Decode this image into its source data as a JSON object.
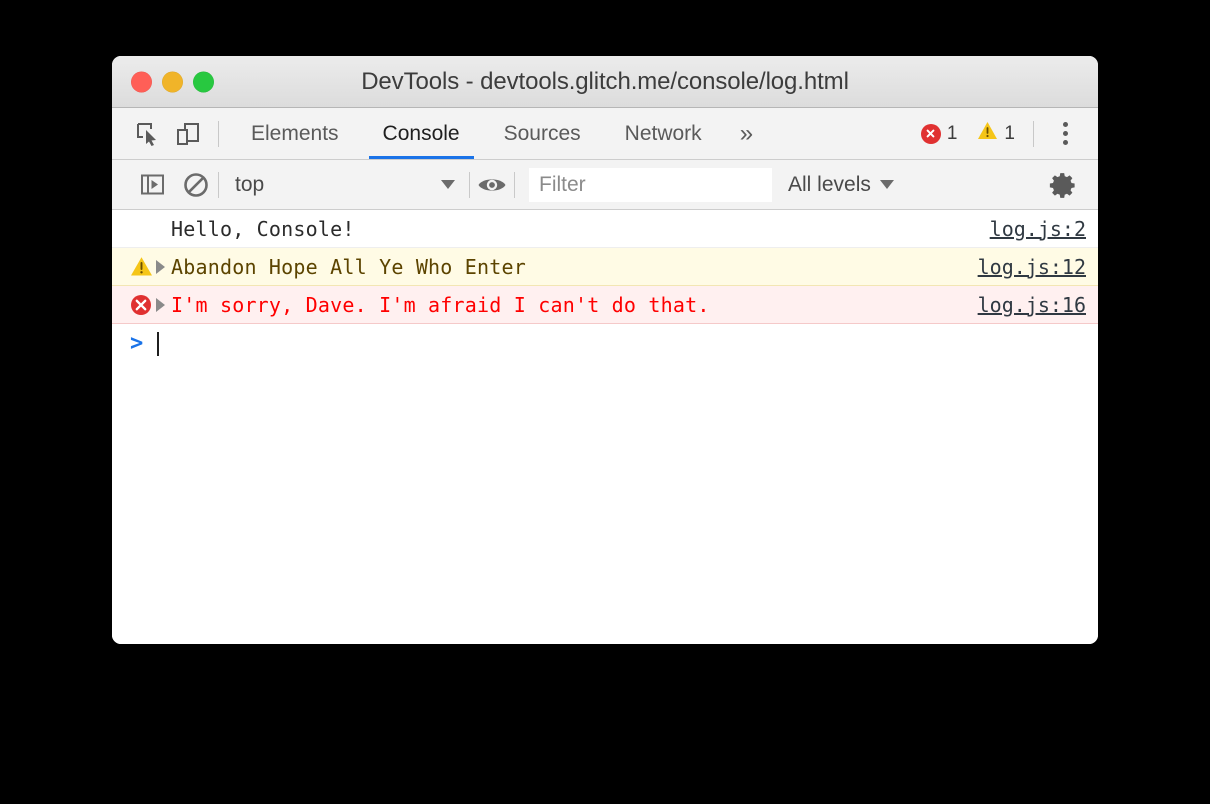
{
  "window": {
    "title": "DevTools - devtools.glitch.me/console/log.html",
    "traffic_lights": [
      {
        "name": "close",
        "color": "#ff5f57"
      },
      {
        "name": "minimize",
        "color": "#f0b429"
      },
      {
        "name": "maximize",
        "color": "#28c840"
      }
    ]
  },
  "tabbar": {
    "inspect_icon": "inspect-element-icon",
    "device_icon": "device-toolbar-icon",
    "tabs": [
      {
        "label": "Elements",
        "active": false
      },
      {
        "label": "Console",
        "active": true
      },
      {
        "label": "Sources",
        "active": false
      },
      {
        "label": "Network",
        "active": false
      }
    ],
    "more_tabs_label": "»",
    "error_count": "1",
    "warning_count": "1",
    "menu_icon": "kebab-menu-icon"
  },
  "console_toolbar": {
    "sidebar_toggle_icon": "console-sidebar-toggle-icon",
    "clear_icon": "clear-console-icon",
    "context_value": "top",
    "eye_icon": "live-expression-eye-icon",
    "filter_placeholder": "Filter",
    "filter_value": "",
    "levels_label": "All levels",
    "settings_icon": "gear-icon"
  },
  "console_messages": [
    {
      "level": "log",
      "icon": "",
      "expandable": false,
      "text": "Hello, Console!",
      "source": "log.js:2"
    },
    {
      "level": "warn",
      "icon": "warning-triangle-icon",
      "expandable": true,
      "text": "Abandon Hope All Ye Who Enter",
      "source": "log.js:12"
    },
    {
      "level": "error",
      "icon": "error-circle-icon",
      "expandable": true,
      "text": "I'm sorry, Dave. I'm afraid I can't do that.",
      "source": "log.js:16"
    }
  ],
  "prompt": {
    "chevron": ">",
    "value": ""
  },
  "colors": {
    "accent": "#1a73e8",
    "error": "#e03131",
    "error_text": "#ff0000",
    "warning": "#f5c518",
    "warning_text": "#5c4400",
    "warning_bg": "#fffbe5",
    "error_bg": "#fff0f0",
    "toolbar_bg": "#f3f3f3",
    "page_bg": "#000000"
  }
}
